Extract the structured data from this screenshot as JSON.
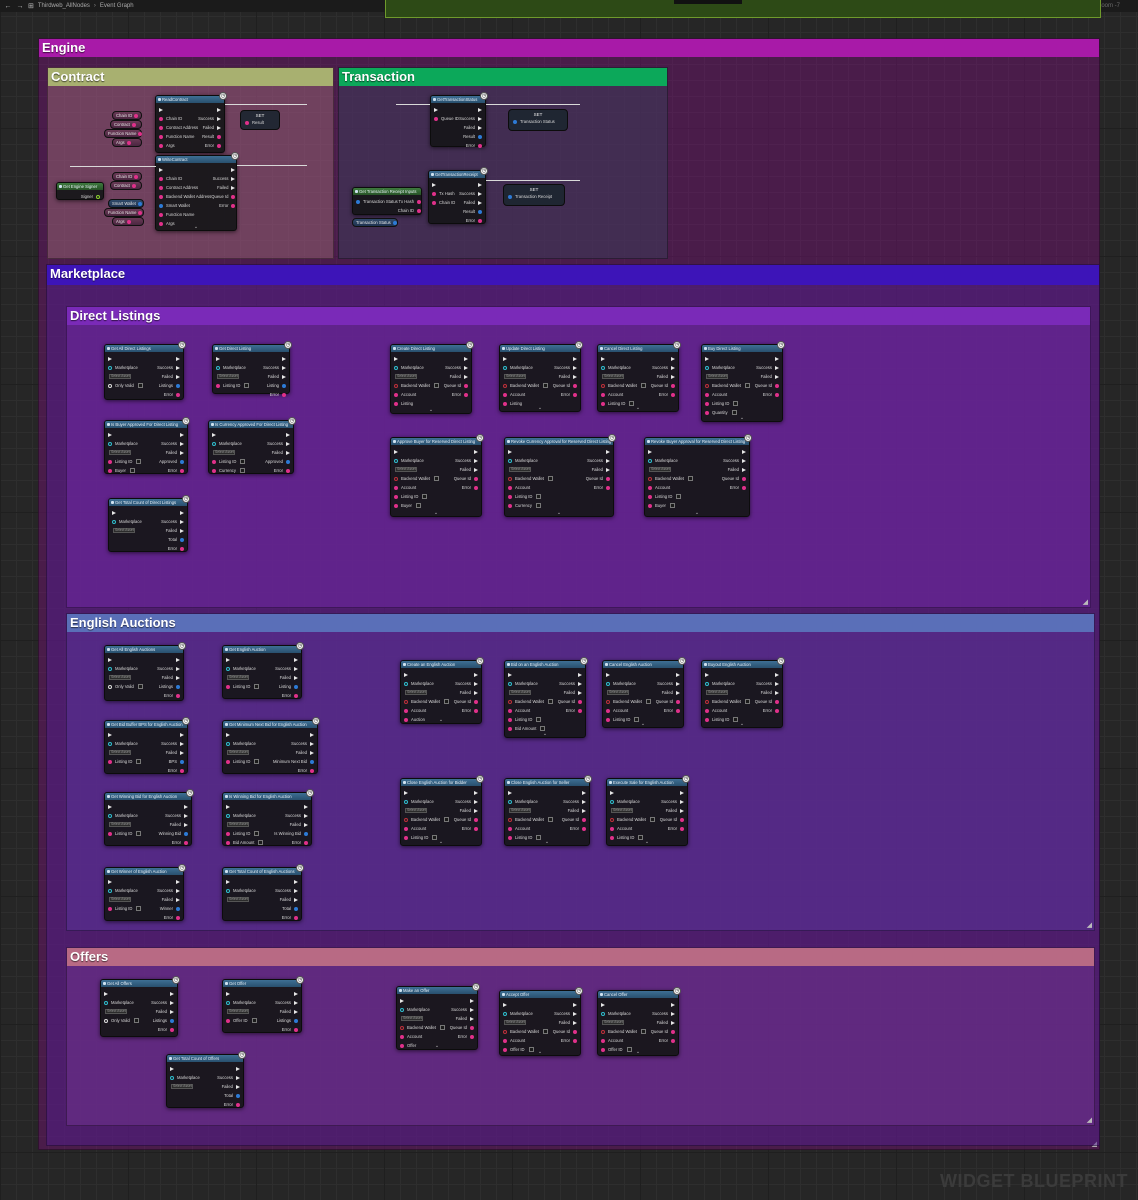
{
  "topbar": {
    "back": "←",
    "forward": "→",
    "asset": "Thirdweb_AllNodes",
    "separator": "›",
    "graph": "Event Graph",
    "zoom": "Zoom -7"
  },
  "watermark": "WIDGET BLUEPRINT",
  "colors": {
    "engine": "#a81aa8",
    "contract": "#a8b070",
    "transaction": "#0ca85a",
    "marketplace": "#3d14b8",
    "direct_listings": "#7a2ab8",
    "english_auctions": "#5a6fb8",
    "offers": "#b86a84"
  },
  "comments": {
    "engine": "Engine",
    "contract": "Contract",
    "transaction": "Transaction",
    "marketplace": "Marketplace",
    "direct_listings": "Direct Listings",
    "english_auctions": "English Auctions",
    "offers": "Offers"
  },
  "common": {
    "select_asset": "Select Asset",
    "clock": "◷",
    "chevron": "⌄",
    "resize": "◢",
    "set": "SET"
  },
  "contract": {
    "read_title": "ReadContract",
    "write_title": "WriteContract",
    "pins_read_left": [
      "Chain ID",
      "Contract Address",
      "Function Name",
      "Args"
    ],
    "pins_read_right": [
      "Success",
      "Failed",
      "Result",
      "Error"
    ],
    "pins_write_left": [
      "Chain ID",
      "Contract Address",
      "Backend Wallet Address",
      "Smart Wallet",
      "Function Name",
      "Args"
    ],
    "pins_write_right": [
      "Success",
      "Failed",
      "Queue Id",
      "Error"
    ],
    "vars_read": [
      "Chain ID",
      "Contract",
      "Function Name",
      "Args"
    ],
    "vars_write": [
      "Chain ID",
      "Contract",
      "Smart Wallet",
      "Function Name",
      "Args"
    ],
    "signer_node": "Get Engine Signer",
    "signer_out": "Signer",
    "set_result": "Result"
  },
  "transaction": {
    "status_title": "GetTransactionStatus",
    "receipt_title": "GetTransactionReceipt",
    "status_left": [
      "Queue ID"
    ],
    "status_right": [
      "Success",
      "Failed",
      "Result",
      "Error"
    ],
    "receipt_left": [
      "Tx Hash",
      "Chain ID"
    ],
    "receipt_right": [
      "Success",
      "Failed",
      "Result",
      "Error"
    ],
    "set_status": "Transaction Status",
    "set_receipt": "Transaction Receipt",
    "break_node": "Get Transaction Receipt Inputs",
    "break_left": "Transaction Status",
    "break_right": [
      "Tx Hash",
      "Chain ID"
    ],
    "var_status": "Transaction Status"
  },
  "direct_listings": {
    "nodes": [
      {
        "title": "Get All Direct Listings",
        "left": [
          "Marketplace",
          "Only Valid"
        ],
        "right": [
          "Success",
          "Failed",
          "Listings",
          "Error"
        ]
      },
      {
        "title": "Get Direct Listing",
        "left": [
          "Marketplace",
          "Listing ID"
        ],
        "right": [
          "Success",
          "Failed",
          "Listing",
          "Error"
        ]
      },
      {
        "title": "Is Buyer Approved For Direct Listing",
        "left": [
          "Marketplace",
          "Listing ID",
          "Buyer"
        ],
        "right": [
          "Success",
          "Failed",
          "Approved",
          "Error"
        ]
      },
      {
        "title": "Is Currency Approved For Direct Listing",
        "left": [
          "Marketplace",
          "Listing ID",
          "Currency"
        ],
        "right": [
          "Success",
          "Failed",
          "Approved",
          "Error"
        ]
      },
      {
        "title": "Get Total Count of Direct Listings",
        "left": [
          "Marketplace"
        ],
        "right": [
          "Success",
          "Failed",
          "Total",
          "Error"
        ]
      },
      {
        "title": "Create Direct Listing",
        "left": [
          "Marketplace",
          "Backend Wallet",
          "Account",
          "Listing"
        ],
        "right": [
          "Success",
          "Failed",
          "Queue Id",
          "Error"
        ]
      },
      {
        "title": "Update Direct Listing",
        "left": [
          "Marketplace",
          "Backend Wallet",
          "Account",
          "Listing"
        ],
        "right": [
          "Success",
          "Failed",
          "Queue Id",
          "Error"
        ]
      },
      {
        "title": "Cancel Direct Listing",
        "left": [
          "Marketplace",
          "Backend Wallet",
          "Account",
          "Listing ID"
        ],
        "right": [
          "Success",
          "Failed",
          "Queue Id",
          "Error"
        ]
      },
      {
        "title": "Buy Direct Listing",
        "left": [
          "Marketplace",
          "Backend Wallet",
          "Account",
          "Listing ID",
          "Quantity"
        ],
        "right": [
          "Success",
          "Failed",
          "Queue Id",
          "Error"
        ]
      },
      {
        "title": "Approve Buyer for Reserved Direct Listing",
        "left": [
          "Marketplace",
          "Backend Wallet",
          "Account",
          "Listing ID",
          "Buyer"
        ],
        "right": [
          "Success",
          "Failed",
          "Queue Id",
          "Error"
        ]
      },
      {
        "title": "Revoke Currency Approval for Reserved Direct Listing",
        "left": [
          "Marketplace",
          "Backend Wallet",
          "Account",
          "Listing ID",
          "Currency"
        ],
        "right": [
          "Success",
          "Failed",
          "Queue Id",
          "Error"
        ]
      },
      {
        "title": "Revoke Buyer Approval for Reserved Direct Listing",
        "left": [
          "Marketplace",
          "Backend Wallet",
          "Account",
          "Listing ID",
          "Buyer"
        ],
        "right": [
          "Success",
          "Failed",
          "Queue Id",
          "Error"
        ]
      }
    ]
  },
  "english_auctions": {
    "nodes": [
      {
        "title": "Get All English Auctions",
        "left": [
          "Marketplace",
          "Only Valid"
        ],
        "right": [
          "Success",
          "Failed",
          "Listings",
          "Error"
        ]
      },
      {
        "title": "Get English Auction",
        "left": [
          "Marketplace",
          "Listing ID"
        ],
        "right": [
          "Success",
          "Failed",
          "Listing",
          "Error"
        ]
      },
      {
        "title": "Get Bid Buffer BPS for English Auction",
        "left": [
          "Marketplace",
          "Listing ID"
        ],
        "right": [
          "Success",
          "Failed",
          "BPS",
          "Error"
        ]
      },
      {
        "title": "Get Minimum Next Bid for English Auction",
        "left": [
          "Marketplace",
          "Listing ID"
        ],
        "right": [
          "Success",
          "Failed",
          "Minimum Next Bid",
          "Error"
        ]
      },
      {
        "title": "Get Winning Bid for English Auction",
        "left": [
          "Marketplace",
          "Listing ID"
        ],
        "right": [
          "Success",
          "Failed",
          "Winning Bid",
          "Error"
        ]
      },
      {
        "title": "Is Winning Bid for English Auction",
        "left": [
          "Marketplace",
          "Listing ID",
          "Bid Amount"
        ],
        "right": [
          "Success",
          "Failed",
          "Is Winning Bid",
          "Error"
        ]
      },
      {
        "title": "Get Winner of English Auction",
        "left": [
          "Marketplace",
          "Listing ID"
        ],
        "right": [
          "Success",
          "Failed",
          "Winner",
          "Error"
        ]
      },
      {
        "title": "Get Total Count of English Auctions",
        "left": [
          "Marketplace"
        ],
        "right": [
          "Success",
          "Failed",
          "Total",
          "Error"
        ]
      },
      {
        "title": "Create an English Auction",
        "left": [
          "Marketplace",
          "Backend Wallet",
          "Account",
          "Auction"
        ],
        "right": [
          "Success",
          "Failed",
          "Queue Id",
          "Error"
        ]
      },
      {
        "title": "Bid on an English Auction",
        "left": [
          "Marketplace",
          "Backend Wallet",
          "Account",
          "Listing ID",
          "Bid Amount"
        ],
        "right": [
          "Success",
          "Failed",
          "Queue Id",
          "Error"
        ]
      },
      {
        "title": "Cancel English Auction",
        "left": [
          "Marketplace",
          "Backend Wallet",
          "Account",
          "Listing ID"
        ],
        "right": [
          "Success",
          "Failed",
          "Queue Id",
          "Error"
        ]
      },
      {
        "title": "Buyout English Auction",
        "left": [
          "Marketplace",
          "Backend Wallet",
          "Account",
          "Listing ID"
        ],
        "right": [
          "Success",
          "Failed",
          "Queue Id",
          "Error"
        ]
      },
      {
        "title": "Close English Auction for Bidder",
        "left": [
          "Marketplace",
          "Backend Wallet",
          "Account",
          "Listing ID"
        ],
        "right": [
          "Success",
          "Failed",
          "Queue Id",
          "Error"
        ]
      },
      {
        "title": "Close English Auction for Seller",
        "left": [
          "Marketplace",
          "Backend Wallet",
          "Account",
          "Listing ID"
        ],
        "right": [
          "Success",
          "Failed",
          "Queue Id",
          "Error"
        ]
      },
      {
        "title": "Execute Sale for English Auction",
        "left": [
          "Marketplace",
          "Backend Wallet",
          "Account",
          "Listing ID"
        ],
        "right": [
          "Success",
          "Failed",
          "Queue Id",
          "Error"
        ]
      }
    ]
  },
  "offers": {
    "nodes": [
      {
        "title": "Get All Offers",
        "left": [
          "Marketplace",
          "Only Valid"
        ],
        "right": [
          "Success",
          "Failed",
          "Listings",
          "Error"
        ]
      },
      {
        "title": "Get Offer",
        "left": [
          "Marketplace",
          "Offer ID"
        ],
        "right": [
          "Success",
          "Failed",
          "Listings",
          "Error"
        ]
      },
      {
        "title": "Get Total Count of Offers",
        "left": [
          "Marketplace"
        ],
        "right": [
          "Success",
          "Failed",
          "Total",
          "Error"
        ]
      },
      {
        "title": "Make an Offer",
        "left": [
          "Marketplace",
          "Backend Wallet",
          "Account",
          "Offer"
        ],
        "right": [
          "Success",
          "Failed",
          "Queue Id",
          "Error"
        ]
      },
      {
        "title": "Accept Offer",
        "left": [
          "Marketplace",
          "Backend Wallet",
          "Account",
          "Offer ID"
        ],
        "right": [
          "Success",
          "Failed",
          "Queue Id",
          "Error"
        ]
      },
      {
        "title": "Cancel Offer",
        "left": [
          "Marketplace",
          "Backend Wallet",
          "Account",
          "Offer ID"
        ],
        "right": [
          "Success",
          "Failed",
          "Queue Id",
          "Error"
        ]
      }
    ]
  }
}
